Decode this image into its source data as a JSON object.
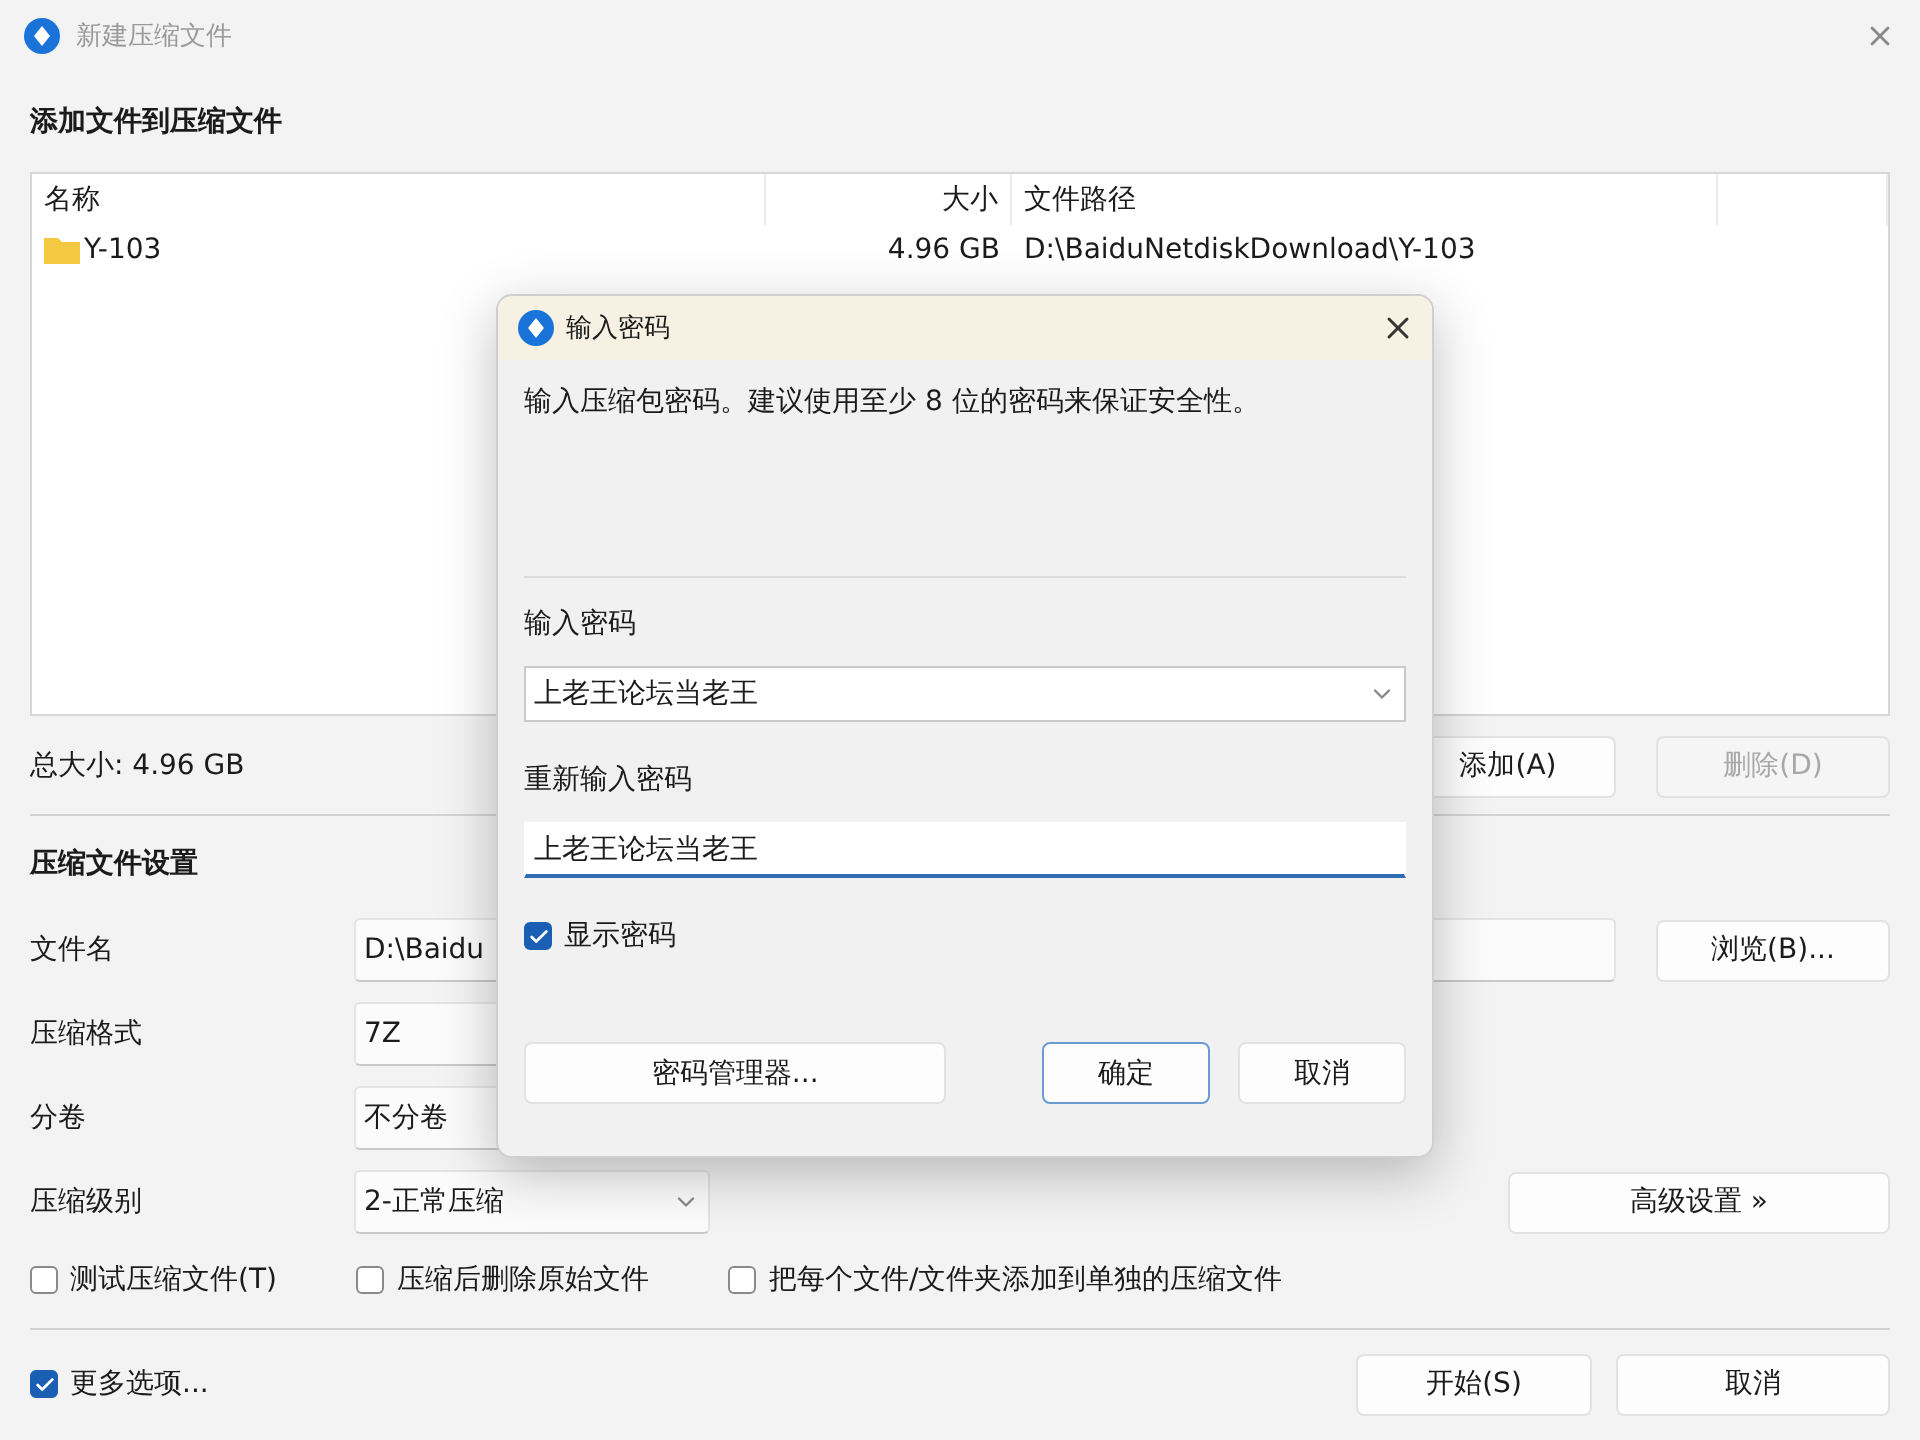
{
  "window": {
    "title": "新建压缩文件",
    "active": false
  },
  "files": {
    "heading": "添加文件到压缩文件",
    "columns": [
      "名称",
      "大小",
      "文件路径"
    ],
    "rows": [
      {
        "kind": "folder",
        "name": "Y-103",
        "size": "4.96 GB",
        "path": "D:\\BaiduNetdiskDownload\\Y-103"
      }
    ]
  },
  "total": "总大小: 4.96 GB",
  "list_buttons": [
    {
      "label": "添加(A)",
      "disabled": false
    },
    {
      "label": "删除(D)",
      "disabled": true
    }
  ],
  "settings": {
    "heading": "压缩文件设置",
    "fields": [
      {
        "label": "文件名",
        "kind": "text",
        "value": "D:\\Baidu"
      },
      {
        "label": "压缩格式",
        "kind": "box",
        "value": "7Z"
      },
      {
        "label": "分卷",
        "kind": "box",
        "value": "不分卷"
      },
      {
        "label": "压缩级别",
        "kind": "select",
        "value": "2-正常压缩"
      }
    ],
    "browse": "浏览(B)...",
    "advanced": "高级设置 »"
  },
  "options": [
    {
      "label": "测试压缩文件(T)",
      "checked": false
    },
    {
      "label": "压缩后删除原始文件",
      "checked": false
    },
    {
      "label": "把每个文件/文件夹添加到单独的压缩文件",
      "checked": false
    }
  ],
  "more_options": {
    "label": "更多选项...",
    "checked": true
  },
  "footer_buttons": [
    "开始(S)",
    "取消"
  ],
  "password_dialog": {
    "title": "输入密码",
    "description": "输入压缩包密码。建议使用至少 8 位的密码来保证安全性。",
    "fields": [
      {
        "label": "输入密码",
        "kind": "combo",
        "value": "上老王论坛当老王",
        "focused": false
      },
      {
        "label": "重新输入密码",
        "kind": "text",
        "value": "上老王论坛当老王",
        "focused": true
      }
    ],
    "show_password": {
      "label": "显示密码",
      "checked": true
    },
    "buttons": [
      {
        "label": "密码管理器...",
        "default": false
      },
      {
        "label": "确定",
        "default": true
      },
      {
        "label": "取消",
        "default": false
      }
    ]
  }
}
